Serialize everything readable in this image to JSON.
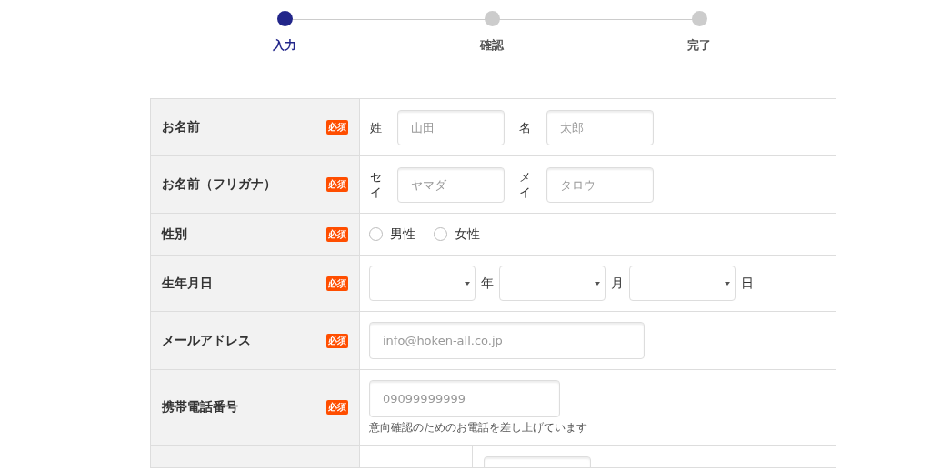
{
  "steps": [
    {
      "label": "入力",
      "selected": true
    },
    {
      "label": "確認",
      "selected": false
    },
    {
      "label": "完了",
      "selected": false
    }
  ],
  "form": {
    "rows": [
      {
        "kind": "name",
        "label": "お名前",
        "badge": "必須",
        "parts": [
          {
            "prefix": "姓",
            "placeholder": "山田"
          },
          {
            "prefix": "名",
            "placeholder": "太郎"
          }
        ]
      },
      {
        "kind": "name",
        "label": "お名前（フリガナ）",
        "badge": "必須",
        "parts": [
          {
            "prefix": "セイ",
            "placeholder": "ヤマダ"
          },
          {
            "prefix": "メイ",
            "placeholder": "タロウ"
          }
        ]
      },
      {
        "kind": "radio",
        "label": "性別",
        "badge": "必須",
        "options": [
          {
            "label": "男性",
            "selected": false
          },
          {
            "label": "女性",
            "selected": false
          }
        ]
      },
      {
        "kind": "date",
        "label": "生年月日",
        "badge": "必須",
        "selects": [
          {
            "suffix": "年"
          },
          {
            "suffix": "月"
          },
          {
            "suffix": "日"
          }
        ]
      },
      {
        "kind": "email",
        "label": "メールアドレス",
        "badge": "必須",
        "placeholder": "info@hoken-all.co.jp"
      },
      {
        "kind": "tel",
        "label": "携帯電話番号",
        "badge": "必須",
        "placeholder": "09099999999",
        "note": "意向確認のためのお電話を差し上げています"
      },
      {
        "kind": "split"
      }
    ]
  }
}
